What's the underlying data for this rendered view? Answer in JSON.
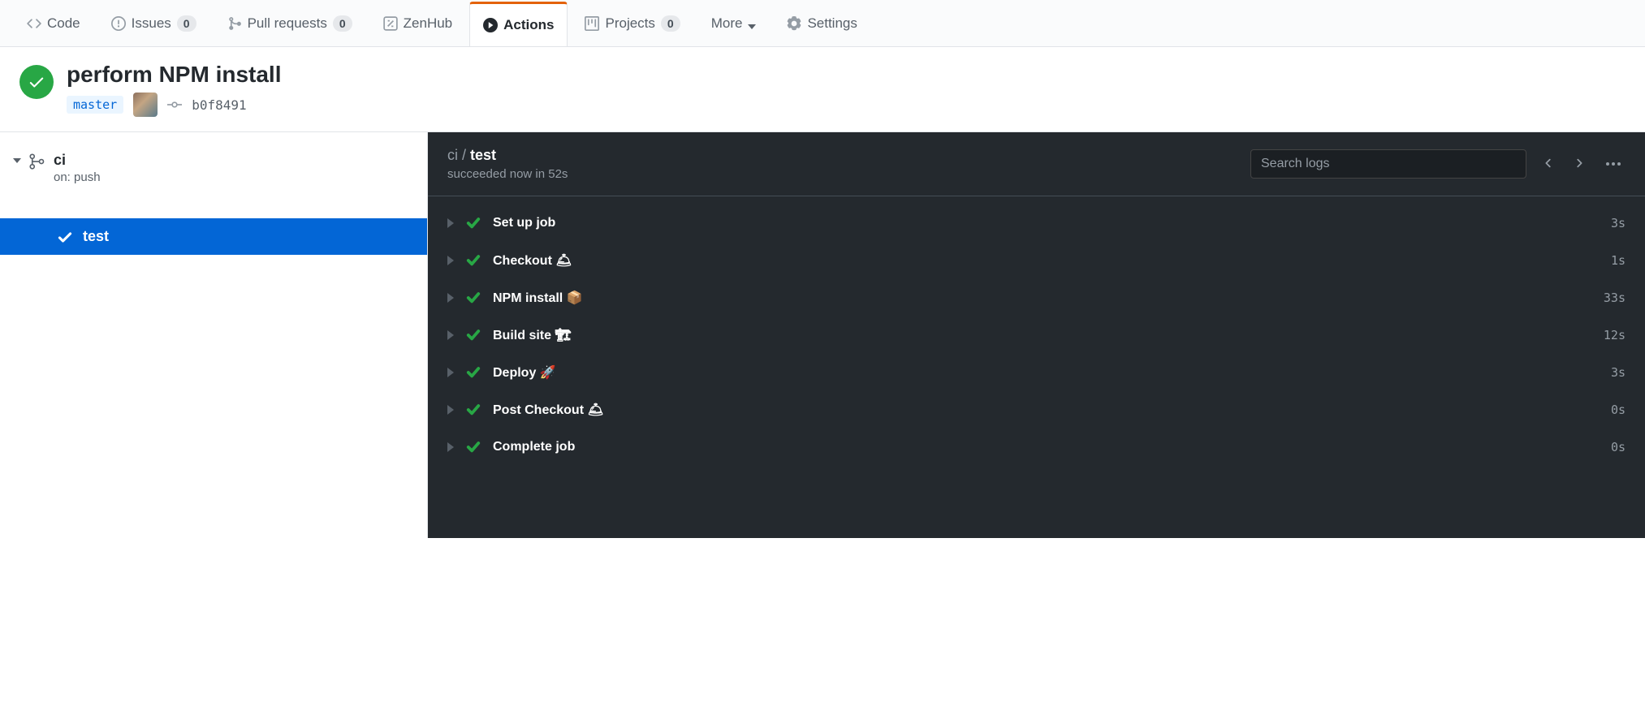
{
  "tabs": {
    "code": "Code",
    "issues": "Issues",
    "issues_count": "0",
    "pulls": "Pull requests",
    "pulls_count": "0",
    "zenhub": "ZenHub",
    "actions": "Actions",
    "projects": "Projects",
    "projects_count": "0",
    "more": "More",
    "settings": "Settings"
  },
  "run": {
    "title": "perform NPM install",
    "branch": "master",
    "sha": "b0f8491"
  },
  "workflow": {
    "name": "ci",
    "trigger": "on: push",
    "job": "test"
  },
  "log": {
    "crumb_workflow": "ci",
    "crumb_sep": " / ",
    "crumb_job": "test",
    "status": "succeeded now in 52s",
    "search_placeholder": "Search logs"
  },
  "steps": [
    {
      "name": "Set up job",
      "time": "3s"
    },
    {
      "name": "Checkout 🛎",
      "time": "1s"
    },
    {
      "name": "NPM install 📦",
      "time": "33s"
    },
    {
      "name": "Build site 🏗",
      "time": "12s"
    },
    {
      "name": "Deploy 🚀",
      "time": "3s"
    },
    {
      "name": "Post Checkout 🛎",
      "time": "0s"
    },
    {
      "name": "Complete job",
      "time": "0s"
    }
  ]
}
